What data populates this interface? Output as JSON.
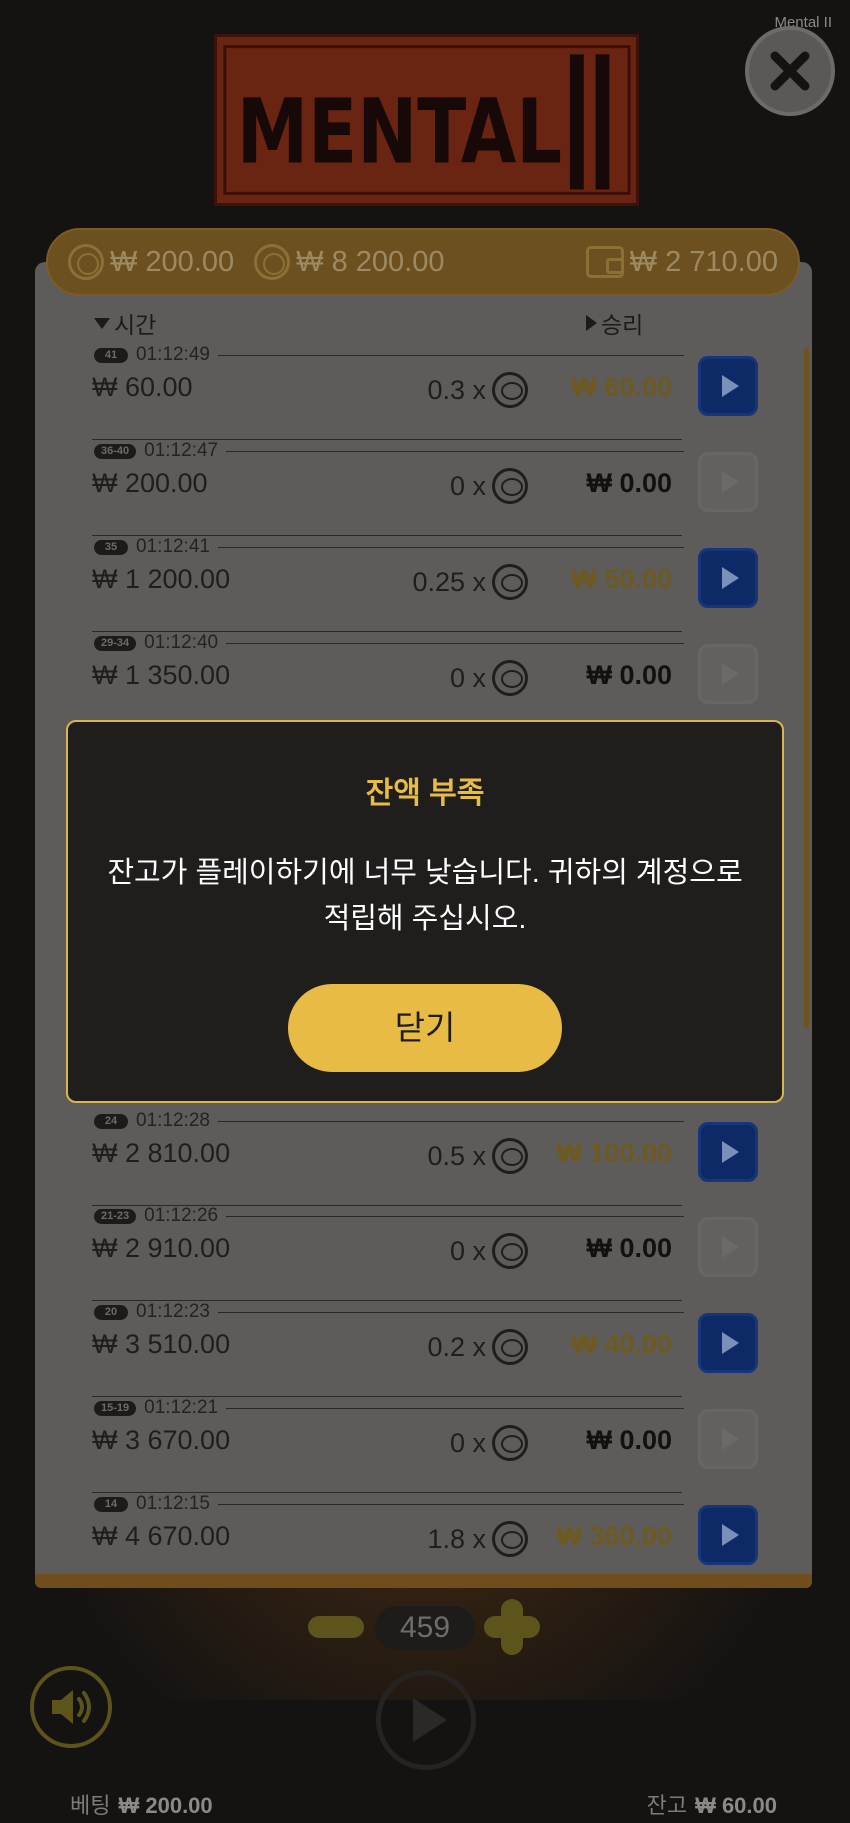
{
  "app": {
    "title": "Mental II",
    "logo_text": "MENTAL II"
  },
  "balance_bar": {
    "bet": "₩ 200.00",
    "total": "₩ 8 200.00",
    "wallet": "₩ 2 710.00"
  },
  "history": {
    "col_time": "시간",
    "col_win": "승리",
    "rows": [
      {
        "badge": "41",
        "time": "01:12:49",
        "bet": "₩ 60.00",
        "mult": "0.3 x",
        "win": "₩ 60.00",
        "gold": true
      },
      {
        "badge": "36-40",
        "time": "01:12:47",
        "bet": "₩ 200.00",
        "mult": "0 x",
        "win": "₩ 0.00",
        "gold": false
      },
      {
        "badge": "35",
        "time": "01:12:41",
        "bet": "₩ 1 200.00",
        "mult": "0.25 x",
        "win": "₩ 50.00",
        "gold": true
      },
      {
        "badge": "29-34",
        "time": "01:12:40",
        "bet": "₩ 1 350.00",
        "mult": "0 x",
        "win": "₩ 0.00",
        "gold": false
      },
      {
        "badge": "24",
        "time": "01:12:28",
        "bet": "₩ 2 810.00",
        "mult": "0.5 x",
        "win": "₩ 100.00",
        "gold": true
      },
      {
        "badge": "21-23",
        "time": "01:12:26",
        "bet": "₩ 2 910.00",
        "mult": "0 x",
        "win": "₩ 0.00",
        "gold": false
      },
      {
        "badge": "20",
        "time": "01:12:23",
        "bet": "₩ 3 510.00",
        "mult": "0.2 x",
        "win": "₩ 40.00",
        "gold": true
      },
      {
        "badge": "15-19",
        "time": "01:12:21",
        "bet": "₩ 3 670.00",
        "mult": "0 x",
        "win": "₩ 0.00",
        "gold": false
      },
      {
        "badge": "14",
        "time": "01:12:15",
        "bet": "₩ 4 670.00",
        "mult": "1.8 x",
        "win": "₩ 360.00",
        "gold": true
      }
    ]
  },
  "controls": {
    "round_count": "459"
  },
  "footer": {
    "bet_label": "베팅",
    "bet_value": "₩ 200.00",
    "balance_label": "잔고",
    "balance_value": "₩ 60.00"
  },
  "modal": {
    "title": "잔액 부족",
    "message": "잔고가 플레이하기에 너무 낮습니다. 귀하의 계정으로 적립해 주십시오.",
    "close_label": "닫기"
  },
  "colors": {
    "accent_gold": "#e8bc44",
    "play_blue": "#1a4fd1",
    "panel_orange": "#e89a2c"
  }
}
